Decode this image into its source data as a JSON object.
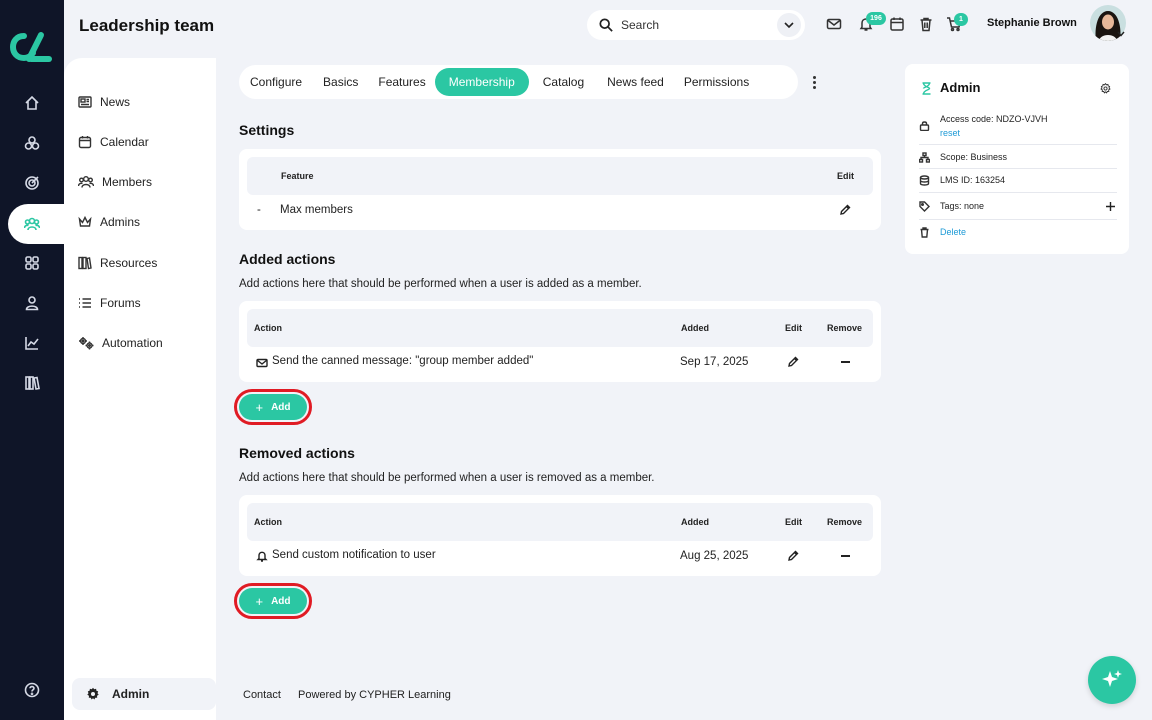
{
  "header": {
    "title": "Leadership team",
    "search_placeholder": "Search",
    "notifications_count": "196",
    "cart_count": "1",
    "user_name": "Stephanie Brown"
  },
  "sidebar": {
    "items": [
      {
        "label": "News",
        "icon": "newspaper-icon"
      },
      {
        "label": "Calendar",
        "icon": "calendar-icon"
      },
      {
        "label": "Members",
        "icon": "members-icon"
      },
      {
        "label": "Admins",
        "icon": "crown-icon"
      },
      {
        "label": "Resources",
        "icon": "books-icon"
      },
      {
        "label": "Forums",
        "icon": "list-icon"
      },
      {
        "label": "Automation",
        "icon": "gears-icon"
      }
    ],
    "admin_label": "Admin"
  },
  "tabs": [
    {
      "label": "Configure"
    },
    {
      "label": "Basics"
    },
    {
      "label": "Features"
    },
    {
      "label": "Membership",
      "active": true
    },
    {
      "label": "Catalog"
    },
    {
      "label": "News feed"
    },
    {
      "label": "Permissions"
    }
  ],
  "settings": {
    "heading": "Settings",
    "col_feature": "Feature",
    "col_edit": "Edit",
    "rows": [
      {
        "bullet": "-",
        "feature": "Max members"
      }
    ]
  },
  "added_actions": {
    "heading": "Added actions",
    "description": "Add actions here that should be performed when a user is added as a member.",
    "col_action": "Action",
    "col_added": "Added",
    "col_edit": "Edit",
    "col_remove": "Remove",
    "rows": [
      {
        "action": "Send the canned message: \"group member added\"",
        "added": "Sep 17, 2025"
      }
    ],
    "add_label": "Add"
  },
  "removed_actions": {
    "heading": "Removed actions",
    "description": "Add actions here that should be performed when a user is removed as a member.",
    "col_action": "Action",
    "col_added": "Added",
    "col_edit": "Edit",
    "col_remove": "Remove",
    "rows": [
      {
        "action": "Send custom notification to user",
        "added": "Aug 25, 2025"
      }
    ],
    "add_label": "Add"
  },
  "footer": {
    "contact": "Contact",
    "powered": "Powered by CYPHER Learning"
  },
  "panel": {
    "title": "Admin",
    "access_code": "Access code: NDZO-VJVH",
    "reset": "reset",
    "scope": "Scope: Business",
    "lms_id": "LMS ID: 163254",
    "tags": "Tags: none",
    "delete": "Delete"
  },
  "colors": {
    "accent": "#2bc7a3",
    "rail": "#0f1528",
    "highlight": "#e01b24",
    "link": "#1d9ad6"
  }
}
